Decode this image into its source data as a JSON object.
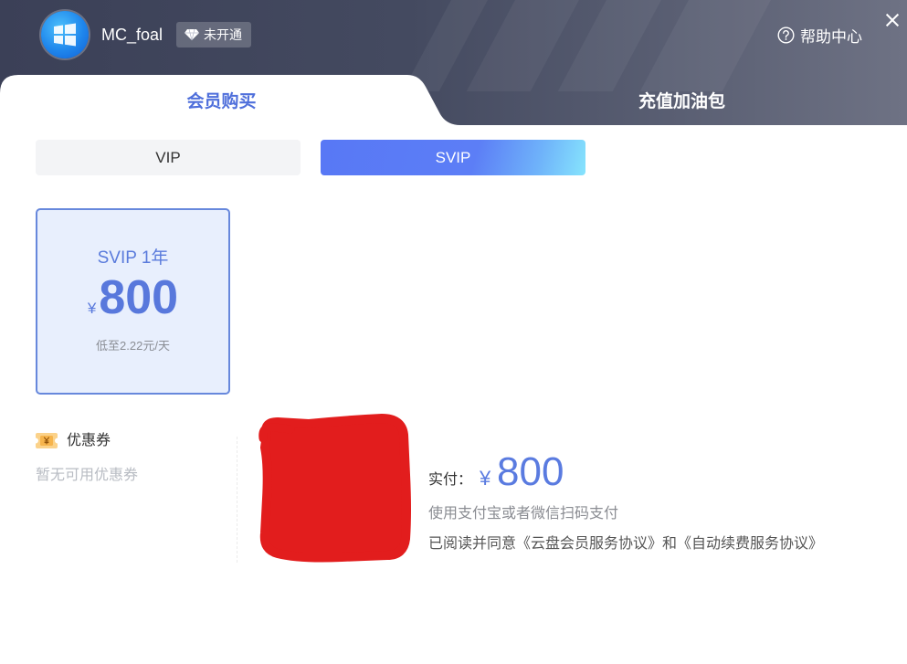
{
  "user": {
    "name": "MC_foal",
    "status_badge": "未开通"
  },
  "header": {
    "help_label": "帮助中心"
  },
  "tabs": [
    {
      "label": "会员购买",
      "active": true
    },
    {
      "label": "充值加油包",
      "active": false
    }
  ],
  "membership_types": [
    {
      "label": "VIP",
      "selected": false
    },
    {
      "label": "SVIP",
      "selected": true
    }
  ],
  "plans": [
    {
      "name": "SVIP 1年",
      "currency": "¥",
      "price": "800",
      "per_day": "低至2.22元/天",
      "selected": true
    }
  ],
  "coupon": {
    "title": "优惠券",
    "empty_text": "暂无可用优惠券"
  },
  "payment": {
    "paid_label": "实付：",
    "currency": "¥",
    "amount": "800",
    "method_hint": "使用支付宝或者微信扫码支付",
    "agreement_prefix": "已阅读并同意",
    "agreement_link_1": "《云盘会员服务协议》",
    "agreement_joiner": "和",
    "agreement_link_2": "《自动续费服务协议》"
  },
  "icons": {
    "avatar": "windows-logo-avatar",
    "badge": "diamond-icon",
    "help": "question-circle-icon",
    "close": "close-icon",
    "coupon": "coupon-ticket-icon"
  },
  "colors": {
    "accent": "#5a7be0",
    "header_dark": "#3b4057",
    "header_light": "#6e7284",
    "card_bg": "#e8effd",
    "card_border": "#6788dc",
    "svip_gradient_start": "#5878f5",
    "svip_gradient_end": "#86e4fd",
    "redaction": "#e21d1d"
  }
}
